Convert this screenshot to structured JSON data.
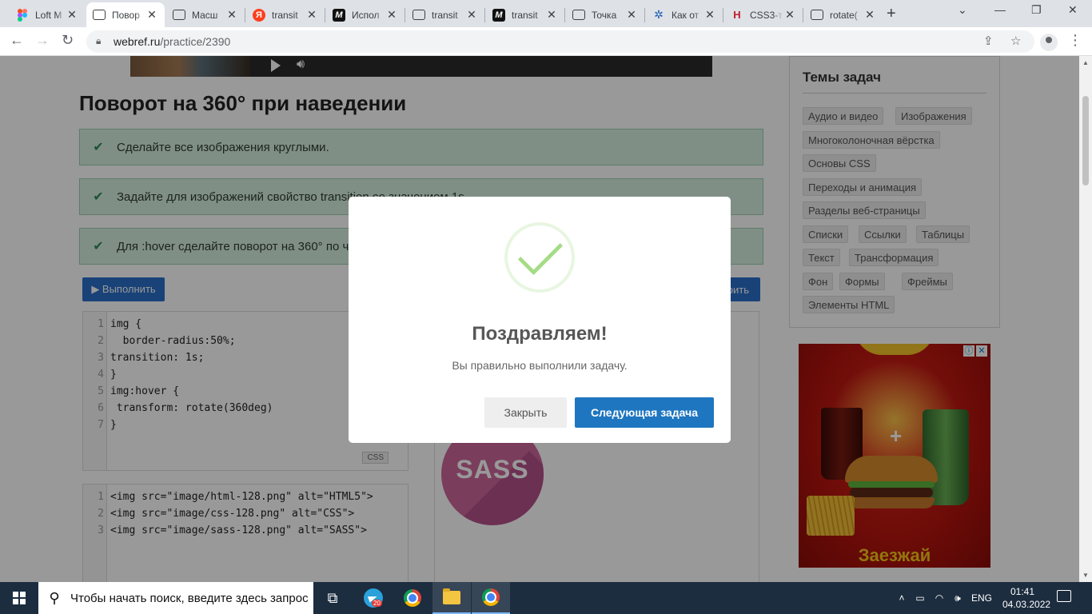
{
  "browser": {
    "tabs": [
      {
        "title": "Loft M",
        "icon": "figma-icon"
      },
      {
        "title": "Повор",
        "icon": "message-icon",
        "active": true
      },
      {
        "title": "Масш",
        "icon": "message-icon"
      },
      {
        "title": "transit",
        "icon": "yandex-icon",
        "icon_text": "Я"
      },
      {
        "title": "Испол",
        "icon": "mdn-icon",
        "icon_text": "M"
      },
      {
        "title": "transit",
        "icon": "message-icon"
      },
      {
        "title": "transit",
        "icon": "mdn-icon",
        "icon_text": "M"
      },
      {
        "title": "Точка",
        "icon": "message-icon"
      },
      {
        "title": "Как от",
        "icon": "network-icon",
        "icon_text": "✲"
      },
      {
        "title": "CSS3-т",
        "icon": "htmlbook-icon",
        "icon_text": "H"
      },
      {
        "title": "rotate(",
        "icon": "message-icon"
      }
    ],
    "close_glyph": "✕",
    "new_tab_glyph": "+",
    "url_host": "webref.ru",
    "url_path": "/practice/2390"
  },
  "page": {
    "title": "Поворот на 360° при наведении",
    "tasks": [
      "Сделайте все изображения круглыми.",
      "Задайте для изображений свойство transition со значением 1s.",
      "Для :hover сделайте поворот на 360° по ч"
    ],
    "run_button": "▶ Выполнить",
    "right_button": "рить",
    "css_editor": {
      "lines": [
        {
          "n": "1",
          "code": "img {"
        },
        {
          "n": "2",
          "code": "  border-radius:50%;"
        },
        {
          "n": "3",
          "code": "transition: 1s;"
        },
        {
          "n": "4",
          "code": "}"
        },
        {
          "n": "5",
          "code": "img:hover {"
        },
        {
          "n": "6",
          "code": " transform: rotate(360deg)"
        },
        {
          "n": "7",
          "code": "}"
        }
      ],
      "lang": "CSS"
    },
    "html_editor": {
      "lines": [
        {
          "n": "1",
          "code": "<img src=\"image/html-128.png\" alt=\"HTML5\">"
        },
        {
          "n": "2",
          "code": "<img src=\"image/css-128.png\" alt=\"CSS\">"
        },
        {
          "n": "3",
          "code": "<img src=\"image/sass-128.png\" alt=\"SASS\">"
        }
      ]
    },
    "result_logo_text": "SASS"
  },
  "sidebar": {
    "header": "Темы задач",
    "tags": [
      "Аудио и видео",
      "Изображения",
      "Многоколоночная вёрстка",
      "Основы CSS",
      "Переходы и анимация",
      "Разделы веб-страницы",
      "Списки",
      "Ссылки",
      "Таблицы",
      "Текст",
      "Трансформация",
      "Фон",
      "Формы",
      "Фреймы",
      "Элементы HTML"
    ],
    "ad_text": "Заезжай"
  },
  "modal": {
    "title": "Поздравляем!",
    "text": "Вы правильно выполнили задачу.",
    "close_button": "Закрыть",
    "next_button": "Следующая задача",
    "success_color": "#a5dc86",
    "next_color": "#1e76c0"
  },
  "taskbar": {
    "search_placeholder": "Чтобы начать поиск, введите здесь запрос",
    "telegram_badge": "20",
    "language": "ENG",
    "time": "01:41",
    "date": "04.03.2022"
  }
}
